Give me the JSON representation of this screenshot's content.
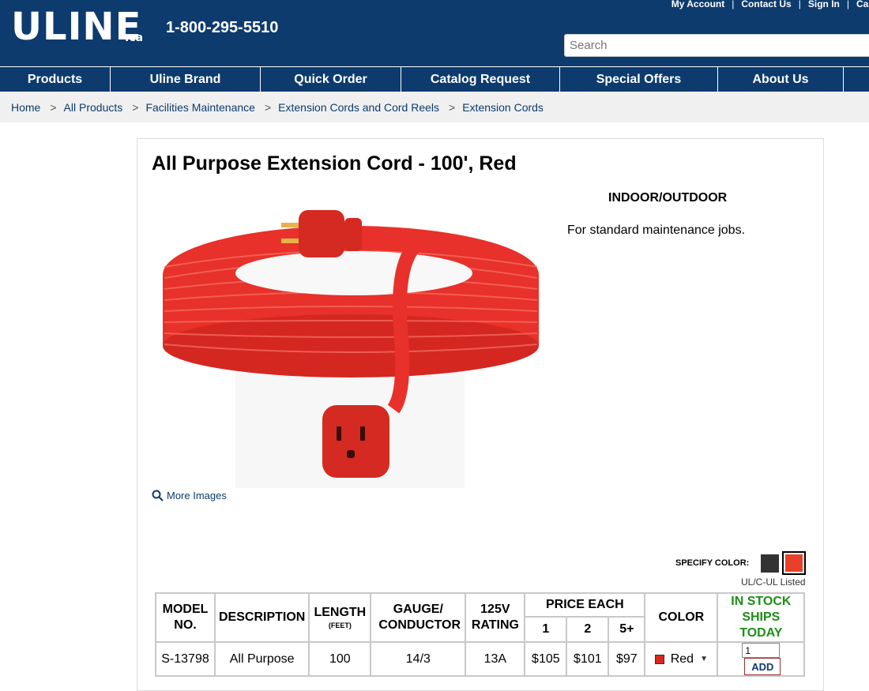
{
  "header": {
    "logo": "ULINE",
    "logo_suffix": ".ca",
    "phone": "1-800-295-5510",
    "top_links": [
      "My Account",
      "Contact Us",
      "Sign In",
      "Cart"
    ],
    "search_placeholder": "Search",
    "background": "#0d3b6e"
  },
  "nav": [
    "Products",
    "Uline Brand",
    "Quick Order",
    "Catalog Request",
    "Special Offers",
    "About Us"
  ],
  "breadcrumb": [
    "Home",
    "All Products",
    "Facilities Maintenance",
    "Extension Cords and Cord Reels",
    "Extension Cords"
  ],
  "product": {
    "title": "All Purpose Extension Cord - 100', Red",
    "feature_heading": "INDOOR/OUTDOOR",
    "feature_text": "For standard maintenance jobs.",
    "more_images": "More Images",
    "specify_color_label": "SPECIFY COLOR:",
    "certification": "UL/C-UL Listed",
    "accent_red": "#e8402a"
  },
  "table": {
    "headers": {
      "model": "MODEL NO.",
      "description": "DESCRIPTION",
      "length": "LENGTH",
      "length_unit": "(FEET)",
      "gauge": "GAUGE/ CONDUCTOR",
      "rating": "125V RATING",
      "price_each": "PRICE EACH",
      "qty1": "1",
      "qty2": "2",
      "qty3": "5+",
      "color": "COLOR",
      "stock_line1": "IN STOCK",
      "stock_line2": "SHIPS TODAY"
    },
    "row": {
      "model": "S-13798",
      "description": "All Purpose",
      "length": "100",
      "gauge": "14/3",
      "rating": "13A",
      "price1": "$105",
      "price2": "$101",
      "price3": "$97",
      "color": "Red",
      "qty_value": "1",
      "add_label": "ADD"
    }
  }
}
